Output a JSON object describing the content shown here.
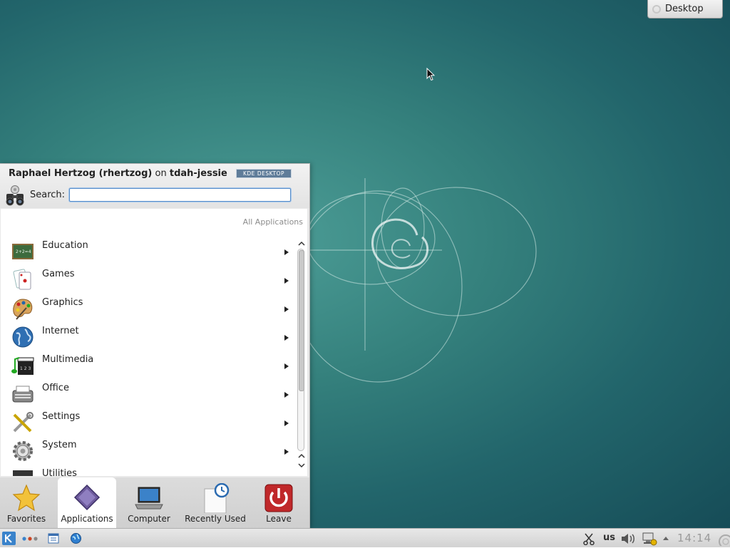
{
  "desktop": {
    "toolbox_label": "Desktop",
    "toolbox_icon": "plasma-toolbox-icon"
  },
  "launcher": {
    "user_display": "Raphael Hertzog (rhertzog)",
    "on_text": "on",
    "host": "tdah-jessie",
    "badge": {
      "left": "KDE",
      "right": "DESKTOP"
    },
    "search": {
      "label": "Search:",
      "value": "",
      "placeholder": ""
    },
    "section_label": "All Applications",
    "categories": [
      {
        "label": "Education",
        "icon": "education-icon"
      },
      {
        "label": "Games",
        "icon": "games-icon"
      },
      {
        "label": "Graphics",
        "icon": "graphics-icon"
      },
      {
        "label": "Internet",
        "icon": "internet-icon"
      },
      {
        "label": "Multimedia",
        "icon": "multimedia-icon"
      },
      {
        "label": "Office",
        "icon": "office-icon"
      },
      {
        "label": "Settings",
        "icon": "settings-icon"
      },
      {
        "label": "System",
        "icon": "system-icon"
      },
      {
        "label": "Utilities",
        "icon": "utilities-icon"
      }
    ],
    "tabs": [
      {
        "label": "Favorites",
        "icon": "star-icon",
        "active": false
      },
      {
        "label": "Applications",
        "icon": "applications-icon",
        "active": true
      },
      {
        "label": "Computer",
        "icon": "computer-icon",
        "active": false
      },
      {
        "label": "Recently Used",
        "icon": "recently-used-icon",
        "active": false
      },
      {
        "label": "Leave",
        "icon": "power-icon",
        "active": false
      }
    ]
  },
  "taskbar": {
    "launchers": [
      "kde-menu-icon",
      "activity-dots-icon",
      "file-manager-icon",
      "browser-icon"
    ],
    "tray": {
      "clipboard_icon": "scissors-icon",
      "keyboard_layout": "us",
      "volume_icon": "volume-icon",
      "network_icon": "network-icon",
      "clock": "14:14"
    }
  },
  "colors": {
    "desktop_teal": "#35817d",
    "kde_blue": "#3a83cb",
    "search_focus": "#5a8ec9",
    "leave_red": "#c0282a"
  }
}
